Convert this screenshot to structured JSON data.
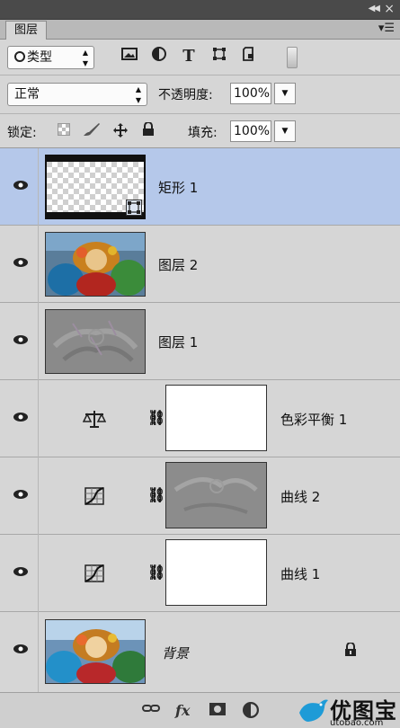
{
  "panel": {
    "tab_label": "图层"
  },
  "toolbar": {
    "filter_label": "类型",
    "text_tool_glyph": "T",
    "filter_icons": [
      "image-filter-icon",
      "adjustment-filter-icon",
      "type-filter-icon",
      "shape-filter-icon",
      "smart-object-filter-icon"
    ]
  },
  "blend": {
    "mode": "正常",
    "opacity_label": "不透明度:",
    "opacity_value": "100%"
  },
  "lock": {
    "label": "锁定:",
    "fill_label": "填充:",
    "fill_value": "100%"
  },
  "layers": [
    {
      "name": "矩形 1",
      "kind": "shape",
      "selected": true
    },
    {
      "name": "图层 2",
      "kind": "image"
    },
    {
      "name": "图层 1",
      "kind": "image"
    },
    {
      "name": "色彩平衡 1",
      "kind": "adjustment",
      "icon": "balance-icon"
    },
    {
      "name": "曲线 2",
      "kind": "adjustment",
      "icon": "curves-icon"
    },
    {
      "name": "曲线 1",
      "kind": "adjustment",
      "icon": "curves-icon"
    },
    {
      "name": "背景",
      "kind": "background",
      "locked": true
    }
  ],
  "footer": {
    "fx_label": "fx",
    "watermark_text": "优图宝",
    "watermark_url": "utobao.com"
  },
  "colors": {
    "panel_bg": "#d6d6d6",
    "selected_row": "#b5c8ea",
    "header_bg": "#4a4a4a"
  }
}
